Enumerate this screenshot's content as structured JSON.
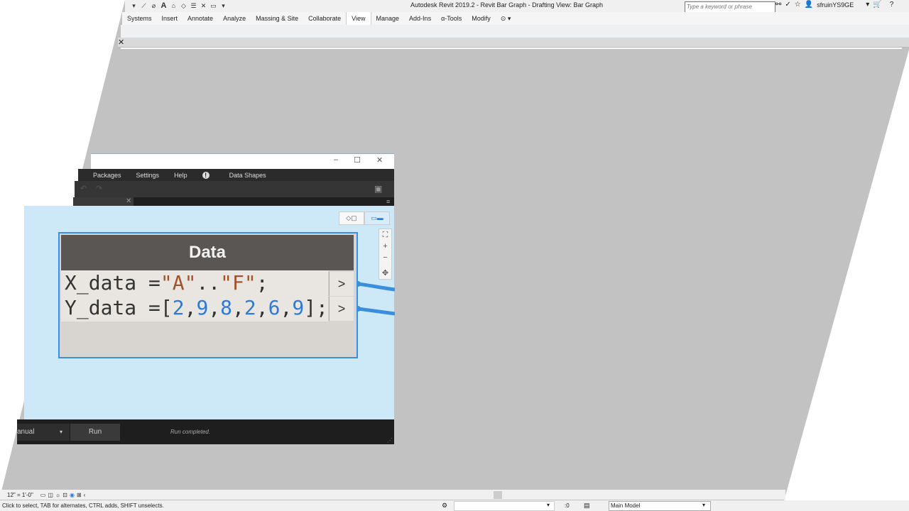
{
  "app": {
    "title": "Autodesk Revit 2019.2 - Revit Bar Graph - Drafting View: Bar Graph",
    "search_placeholder": "Type a keyword or phrase",
    "username": "sfruinYS9GE"
  },
  "ribbon": {
    "tabs": [
      "Systems",
      "Insert",
      "Annotate",
      "Analyze",
      "Massing & Site",
      "Collaborate",
      "View",
      "Manage",
      "Add-Ins",
      "α-Tools",
      "Modify"
    ],
    "active_tab": "View"
  },
  "dynamo": {
    "menu": [
      "Packages",
      "Settings",
      "Help"
    ],
    "extension": "Data Shapes",
    "node": {
      "title": "Data",
      "line1": {
        "var": "X_data",
        "op": " =",
        "s1": "\"A\"",
        "mid": "..",
        "s2": "\"F\"",
        "end": ";"
      },
      "line2": {
        "var": "Y_data",
        "op": " =",
        "values": [
          "2",
          "9",
          "8",
          "2",
          "6",
          "9"
        ],
        "end": "];"
      },
      "port_label": ">"
    },
    "run_mode": "anual",
    "run_label": "Run",
    "run_status": "Run completed."
  },
  "status": {
    "message": "Click to select, TAB for alternates, CTRL adds, SHIFT unselects.",
    "scale": "12\" = 1'-0\"",
    "count": ":0",
    "model": "Main Model"
  }
}
